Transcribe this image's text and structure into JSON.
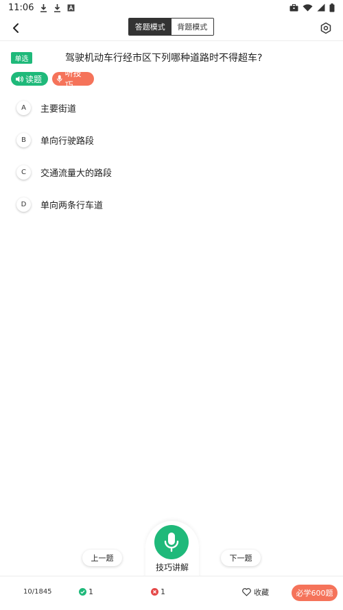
{
  "status_bar": {
    "time": "11:06",
    "icons": [
      "download-icon",
      "download-icon",
      "a-icon",
      "briefcase-icon",
      "wifi-icon",
      "signal-icon",
      "battery-icon"
    ]
  },
  "header": {
    "tabs": [
      {
        "label": "答题模式",
        "active": true
      },
      {
        "label": "背题模式",
        "active": false
      }
    ]
  },
  "question": {
    "type": "单选",
    "text": "驾驶机动车行经市区下列哪种道路时不得超车?"
  },
  "tools": {
    "read": "读题",
    "listen": "听技巧"
  },
  "options": [
    {
      "letter": "A",
      "text": "主要街道"
    },
    {
      "letter": "B",
      "text": "单向行驶路段"
    },
    {
      "letter": "C",
      "text": "交通流量大的路段"
    },
    {
      "letter": "D",
      "text": "单向两条行车道"
    }
  ],
  "controls": {
    "prev": "上一题",
    "next": "下一题",
    "mic_label": "技巧讲解"
  },
  "bottom_bar": {
    "progress": "10/1845",
    "correct_count": "1",
    "wrong_count": "1",
    "favorite": "收藏",
    "must_learn": "必学600题"
  },
  "colors": {
    "accent_green": "#1fb97a",
    "accent_orange": "#f5735a",
    "wrong_red": "#e54848"
  }
}
